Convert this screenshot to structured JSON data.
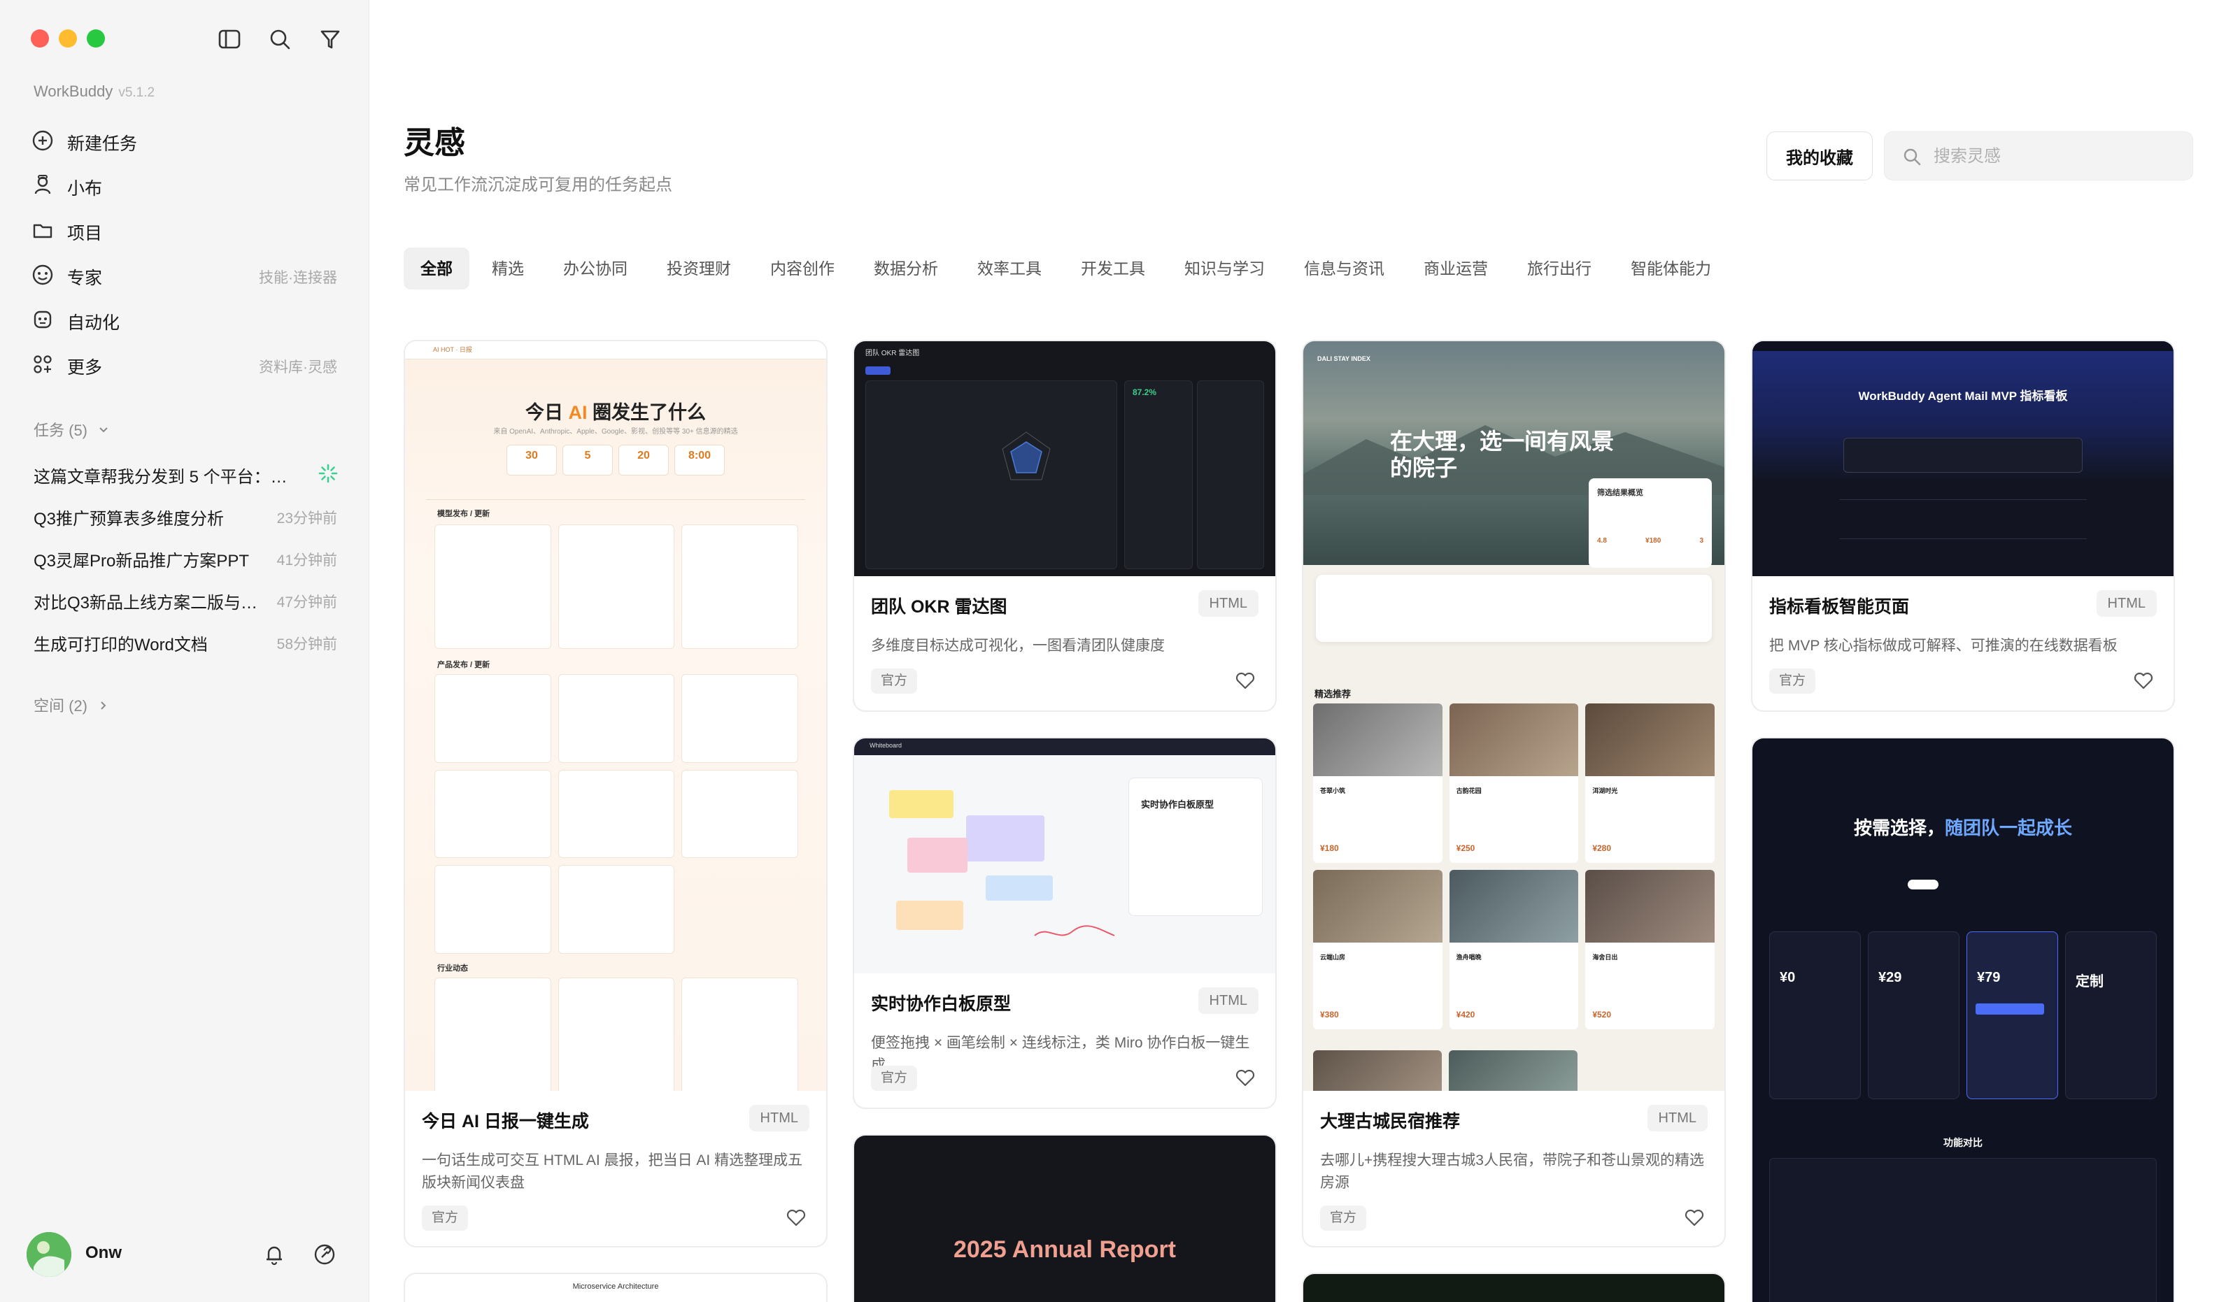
{
  "app": {
    "name": "WorkBuddy",
    "version": "v5.1.2"
  },
  "sidebar": {
    "nav": [
      {
        "label": "新建任务",
        "right": ""
      },
      {
        "label": "小布",
        "right": ""
      },
      {
        "label": "项目",
        "right": ""
      },
      {
        "label": "专家",
        "right": "技能·连接器"
      },
      {
        "label": "自动化",
        "right": ""
      },
      {
        "label": "更多",
        "right": "资料库·灵感"
      }
    ],
    "tasks_header": "任务 (5)",
    "tasks": [
      {
        "title": "这篇文章帮我分发到 5 个平台：…",
        "time": ""
      },
      {
        "title": "Q3推广预算表多维度分析",
        "time": "23分钟前"
      },
      {
        "title": "Q3灵犀Pro新品推广方案PPT",
        "time": "41分钟前"
      },
      {
        "title": "对比Q3新品上线方案二版与…",
        "time": "47分钟前"
      },
      {
        "title": "生成可打印的Word文档",
        "time": "58分钟前"
      }
    ],
    "spaces_header": "空间 (2)",
    "user": {
      "name": "Onw"
    }
  },
  "page": {
    "title": "灵感",
    "subtitle": "常见工作流沉淀成可复用的任务起点",
    "favorites_label": "我的收藏",
    "search_placeholder": "搜索灵感"
  },
  "tabs": [
    "全部",
    "精选",
    "办公协同",
    "投资理财",
    "内容创作",
    "数据分析",
    "效率工具",
    "开发工具",
    "知识与学习",
    "信息与资讯",
    "商业运营",
    "旅行出行",
    "智能体能力"
  ],
  "active_tab": "全部",
  "cards": [
    {
      "title": "今日 AI 日报一键生成",
      "badge": "HTML",
      "desc": "一句话生成可交互 HTML AI 晨报，把当日 AI 精选整理成五版块新闻仪表盘",
      "tag": "官方",
      "thumb": {
        "headline_a": "今日 ",
        "headline_ai": "AI",
        "headline_b": " 圈发生了什么",
        "sub": "来自 OpenAI、Anthropic、Apple、Google、影视、创投等等 30+ 信息源的精选",
        "stats": [
          "30",
          "5",
          "20",
          "8:00"
        ],
        "sections": [
          "模型发布 / 更新",
          "产品发布 / 更新",
          "行业动态"
        ]
      }
    },
    {
      "title": "团队 OKR 雷达图",
      "badge": "HTML",
      "desc": "多维度目标达成可视化，一图看清团队健康度",
      "tag": "官方",
      "thumb": {
        "header": "团队 OKR 雷达图",
        "pct": "87.2%"
      }
    },
    {
      "title": "实时协作白板原型",
      "badge": "HTML",
      "desc": "便签拖拽 × 画笔绘制 × 连线标注，类 Miro 协作白板一键生成",
      "tag": "官方",
      "thumb": {
        "app": "Whiteboard",
        "panel_title": "实时协作白板原型"
      }
    },
    {
      "title": "大理古城民宿推荐",
      "badge": "HTML",
      "desc": "去哪儿+携程搜大理古城3人民宿，带院子和苍山景观的精选房源",
      "tag": "官方",
      "thumb": {
        "brand": "DALI STAY INDEX",
        "hero": "在大理，选一间有风景的院子",
        "section": "精选推荐",
        "panel": "筛选结果概览",
        "stats": [
          "4.8",
          "¥180",
          "3"
        ],
        "listings": [
          {
            "name": "苍翠小筑",
            "price": "¥180"
          },
          {
            "name": "古韵花园",
            "price": "¥250"
          },
          {
            "name": "洱湖时光",
            "price": "¥280"
          },
          {
            "name": "云端山房",
            "price": "¥380"
          },
          {
            "name": "渔舟唱晚",
            "price": "¥420"
          },
          {
            "name": "海舍日出",
            "price": "¥520"
          }
        ]
      }
    },
    {
      "title": "指标看板智能页面",
      "badge": "HTML",
      "desc": "把 MVP 核心指标做成可解释、可推演的在线数据看板",
      "tag": "官方",
      "thumb": {
        "header": "WorkBuddy Agent Mail MVP 指标看板"
      }
    },
    {
      "title": "",
      "badge": "",
      "desc": "",
      "tag": "",
      "thumb": {
        "headline_a": "按需选择，",
        "headline_b": "随团队一起成长",
        "plans": [
          {
            "price": "¥0"
          },
          {
            "price": "¥29"
          },
          {
            "price": "¥79"
          },
          {
            "price": "定制"
          }
        ],
        "compare": "功能对比"
      }
    },
    {
      "title": "",
      "badge": "",
      "desc": "",
      "tag": "",
      "thumb": {
        "header": "Microservice Architecture"
      }
    },
    {
      "title": "",
      "badge": "",
      "desc": "",
      "tag": "",
      "thumb": {
        "header": "2025 Annual Report"
      }
    }
  ],
  "colors": {
    "accent": "#1a1a1a",
    "ai_orange": "#f08a24",
    "pink": "#f0508c",
    "blue": "#4a6cf7"
  }
}
